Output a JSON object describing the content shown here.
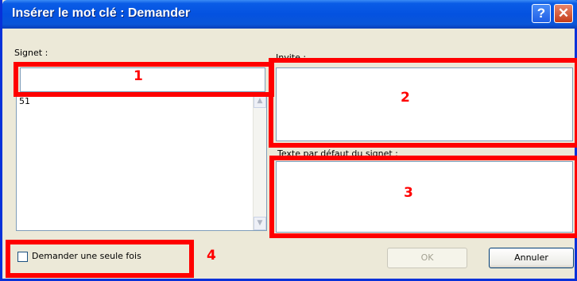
{
  "dialog": {
    "title": "Insérer le mot clé : Demander",
    "help_glyph": "?",
    "close_glyph": "✕"
  },
  "bookmark": {
    "label": "Signet :",
    "value": "",
    "list_items": [
      "51"
    ]
  },
  "prompt": {
    "label": "Invite :",
    "value": ""
  },
  "default_text": {
    "label": "Texte par défaut du signet :",
    "value": ""
  },
  "ask_once": {
    "label": "Demander une seule fois",
    "checked": false
  },
  "buttons": {
    "ok": "OK",
    "cancel": "Annuler"
  },
  "annotations": [
    "1",
    "2",
    "3",
    "4"
  ],
  "colors": {
    "titlebar": "#0452e0",
    "dialog_bg": "#ece9d8",
    "annotation": "#ff0000",
    "field_border": "#7f9db9"
  }
}
